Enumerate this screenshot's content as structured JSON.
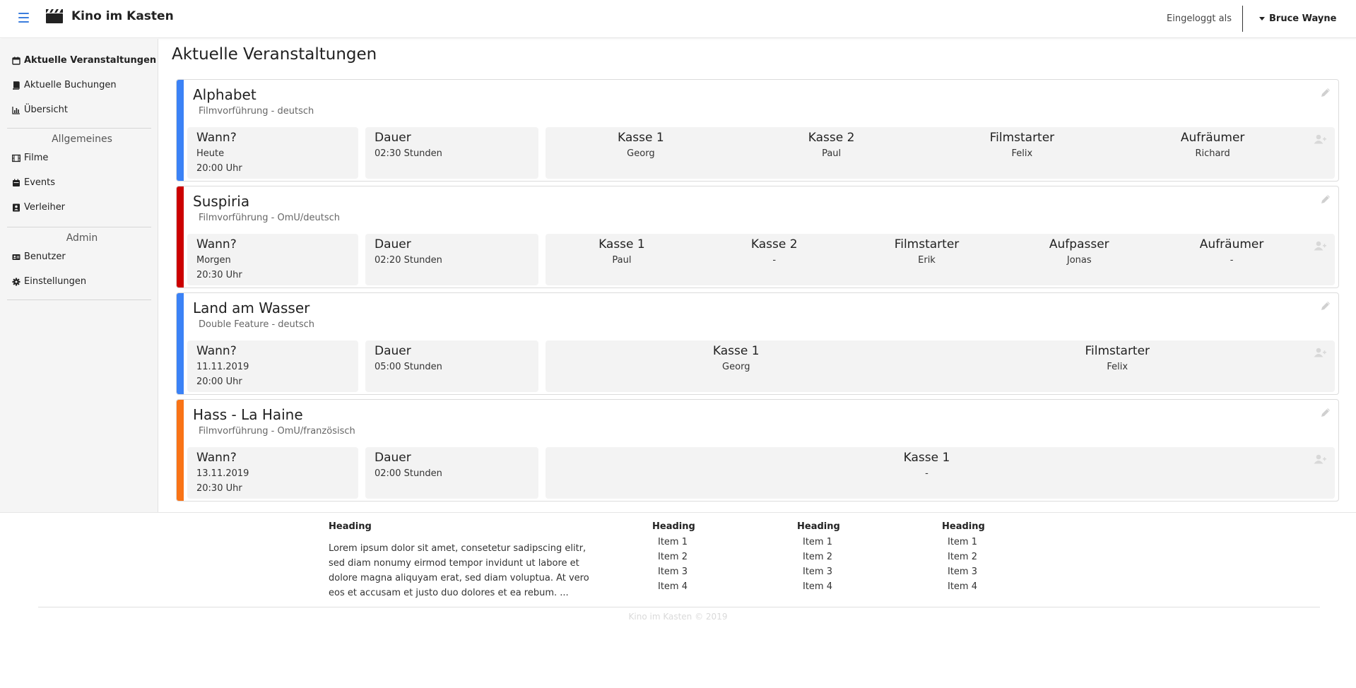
{
  "header": {
    "brand": "Kino im Kasten",
    "logged_in_label": "Eingeloggt als",
    "user": "Bruce Wayne"
  },
  "sidebar": {
    "items": [
      {
        "label": "Aktuelle Veranstaltungen",
        "icon": "calendar-icon",
        "active": true
      },
      {
        "label": "Aktuelle Buchungen",
        "icon": "book-icon"
      },
      {
        "label": "Übersicht",
        "icon": "bar-chart-icon"
      }
    ],
    "general_heading": "Allgemeines",
    "general_items": [
      {
        "label": "Filme",
        "icon": "film-icon"
      },
      {
        "label": "Events",
        "icon": "calendar-icon"
      },
      {
        "label": "Verleiher",
        "icon": "contact-icon"
      }
    ],
    "admin_heading": "Admin",
    "admin_items": [
      {
        "label": "Benutzer",
        "icon": "id-card-icon"
      },
      {
        "label": "Einstellungen",
        "icon": "gear-icon"
      }
    ]
  },
  "main": {
    "title": "Aktuelle Veranstaltungen",
    "labels": {
      "when": "Wann?",
      "duration": "Dauer"
    },
    "events": [
      {
        "title": "Alphabet",
        "subtitle": "Filmvorführung - deutsch",
        "color": "#3b82f6",
        "when_date": "Heute",
        "when_time": "20:00 Uhr",
        "duration": "02:30 Stunden",
        "staff": [
          {
            "role": "Kasse 1",
            "name": "Georg"
          },
          {
            "role": "Kasse 2",
            "name": "Paul"
          },
          {
            "role": "Filmstarter",
            "name": "Felix"
          },
          {
            "role": "Aufräumer",
            "name": "Richard"
          }
        ]
      },
      {
        "title": "Suspiria",
        "subtitle": "Filmvorführung - OmU/deutsch",
        "color": "#cc0000",
        "when_date": "Morgen",
        "when_time": "20:30 Uhr",
        "duration": "02:20 Stunden",
        "staff": [
          {
            "role": "Kasse 1",
            "name": "Paul"
          },
          {
            "role": "Kasse 2",
            "name": "-"
          },
          {
            "role": "Filmstarter",
            "name": "Erik"
          },
          {
            "role": "Aufpasser",
            "name": "Jonas"
          },
          {
            "role": "Aufräumer",
            "name": "-"
          }
        ]
      },
      {
        "title": "Land am Wasser",
        "subtitle": "Double Feature - deutsch",
        "color": "#3b82f6",
        "when_date": "11.11.2019",
        "when_time": "20:00 Uhr",
        "duration": "05:00 Stunden",
        "staff": [
          {
            "role": "Kasse 1",
            "name": "Georg"
          },
          {
            "role": "Filmstarter",
            "name": "Felix"
          }
        ]
      },
      {
        "title": "Hass - La Haine",
        "subtitle": "Filmvorführung - OmU/französisch",
        "color": "#f97316",
        "when_date": "13.11.2019",
        "when_time": "20:30 Uhr",
        "duration": "02:00 Stunden",
        "staff": [
          {
            "role": "Kasse 1",
            "name": "-"
          }
        ]
      }
    ]
  },
  "footer": {
    "about_heading": "Heading",
    "about_text": "Lorem ipsum dolor sit amet, consetetur sadipscing elitr, sed diam nonumy eirmod tempor invidunt ut labore et dolore magna aliquyam erat, sed diam voluptua. At vero eos et accusam et justo duo dolores et ea rebum. ...",
    "columns": [
      {
        "heading": "Heading",
        "items": [
          "Item 1",
          "Item 2",
          "Item 3",
          "Item 4"
        ]
      },
      {
        "heading": "Heading",
        "items": [
          "Item 1",
          "Item 2",
          "Item 3",
          "Item 4"
        ]
      },
      {
        "heading": "Heading",
        "items": [
          "Item 1",
          "Item 2",
          "Item 3",
          "Item 4"
        ]
      }
    ],
    "copyright": "Kino im Kasten © 2019"
  }
}
